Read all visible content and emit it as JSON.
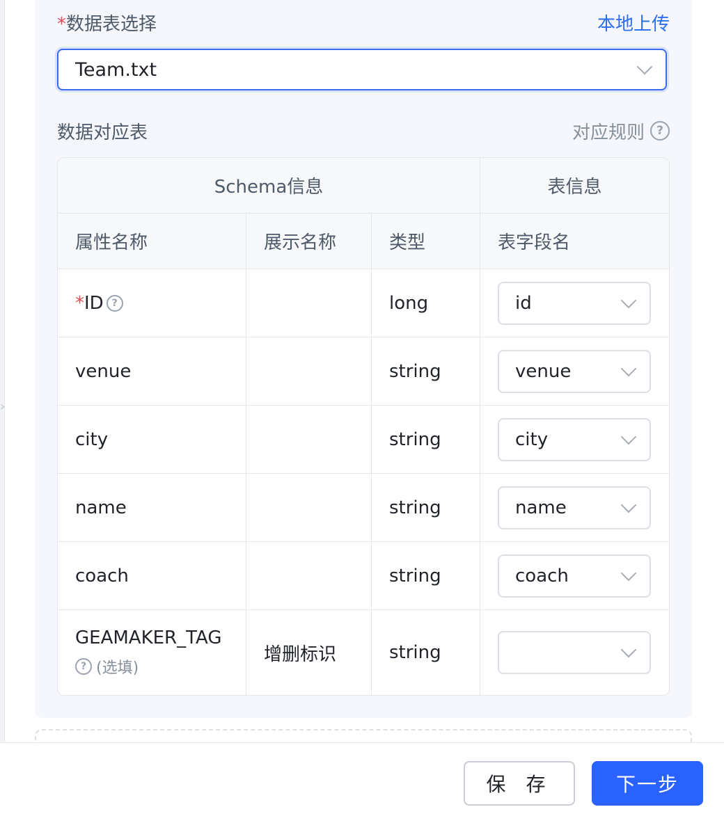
{
  "form": {
    "required_mark": "*",
    "table_select_label": "数据表选择",
    "upload_link": "本地上传",
    "table_select_value": "Team.txt",
    "mapping_title": "数据对应表",
    "mapping_rule_link": "对应规则"
  },
  "table": {
    "group_headers": [
      "Schema信息",
      "表信息"
    ],
    "columns": [
      "属性名称",
      "展示名称",
      "类型",
      "表字段名"
    ],
    "rows": [
      {
        "attr": "ID",
        "required": "*",
        "display": "",
        "type": "long",
        "field": "id"
      },
      {
        "attr": "venue",
        "display": "",
        "type": "string",
        "field": "venue"
      },
      {
        "attr": "city",
        "display": "",
        "type": "string",
        "field": "city"
      },
      {
        "attr": "name",
        "display": "",
        "type": "string",
        "field": "name"
      },
      {
        "attr": "coach",
        "display": "",
        "type": "string",
        "field": "coach"
      },
      {
        "attr": "GEAMAKER_TAG",
        "optional": "(选填)",
        "display": "增删标识",
        "type": "string",
        "field": ""
      }
    ]
  },
  "footer": {
    "save_label": "保 存",
    "next_label": "下一步"
  },
  "icons": {
    "help": "help-icon",
    "dropdown": "chevron-down-icon"
  },
  "colors": {
    "accent": "#2962ff",
    "required": "#e34d59",
    "link": "#2a6ff0"
  }
}
